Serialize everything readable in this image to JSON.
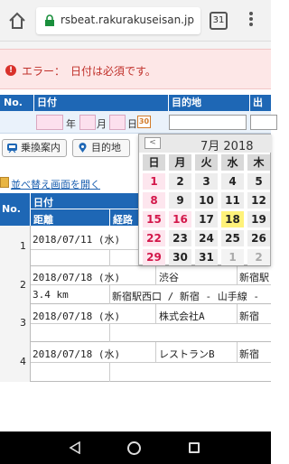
{
  "browser": {
    "url": "rsbeat.rakurakuseisan.jp",
    "tab_count": "31",
    "icons": [
      "home-icon",
      "lock-icon",
      "more-icon"
    ]
  },
  "error": {
    "icon": "!",
    "message": "エラー：　日付は必須です。"
  },
  "form_header": {
    "no": "No.",
    "date": "日付",
    "destination": "目的地",
    "departure": "出発"
  },
  "date_input": {
    "year_label": "年",
    "month_label": "月",
    "day_label": "日",
    "calendar_icon_text": "30"
  },
  "buttons": {
    "transfer": "乗換案内",
    "destination": "目的地"
  },
  "sort_link": "並べ替え画面を開く",
  "table": {
    "header": {
      "no": "No.",
      "date": "日付",
      "distance": "距離",
      "route": "経路"
    },
    "rows": [
      {
        "no": "1",
        "date": "2018/07/11 (水)",
        "place": "",
        "dest": "",
        "distance": "",
        "route": ""
      },
      {
        "no": "2",
        "date": "2018/07/18 (水)",
        "place": "渋谷",
        "dest": "新宿駅",
        "distance": "3.4 km",
        "route": "新宿駅西口 / 新宿 - 山手線 -"
      },
      {
        "no": "3",
        "date": "2018/07/18 (水)",
        "place": "株式会社A",
        "dest": "新宿",
        "distance": "",
        "route": ""
      },
      {
        "no": "4",
        "date": "2018/07/18 (水)",
        "place": "レストランB",
        "dest": "新宿",
        "distance": "",
        "route": ""
      }
    ]
  },
  "calendar": {
    "month_label": "7月 2018",
    "prev_label": "<",
    "weekdays": [
      "日",
      "月",
      "火",
      "水",
      "木"
    ],
    "weeks": [
      [
        "1",
        "2",
        "3",
        "4",
        "5"
      ],
      [
        "8",
        "9",
        "10",
        "11",
        "12"
      ],
      [
        "15",
        "16",
        "17",
        "18",
        "19"
      ],
      [
        "22",
        "23",
        "24",
        "25",
        "26"
      ],
      [
        "29",
        "30",
        "31",
        "1",
        "2"
      ]
    ],
    "holiday": "16",
    "today": "18",
    "colors": {
      "sunday": "#d3174a",
      "today_bg": "#fff27a",
      "header_bg": "#1e67b5"
    }
  }
}
